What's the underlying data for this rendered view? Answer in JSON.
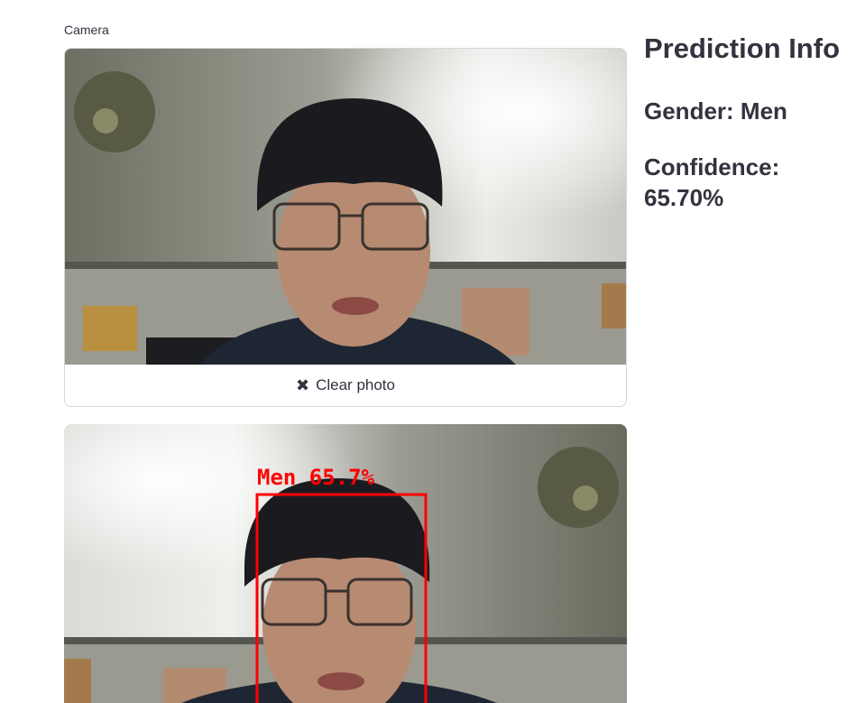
{
  "camera": {
    "label": "Camera",
    "clear_label": "Clear photo",
    "clear_icon": "close-icon"
  },
  "prediction": {
    "title": "Prediction Info",
    "gender_text": "Gender: Men",
    "confidence_text": "Confidence: 65.70%"
  },
  "detection": {
    "label": "Men 65.7%",
    "box_color": "#ff0000"
  }
}
